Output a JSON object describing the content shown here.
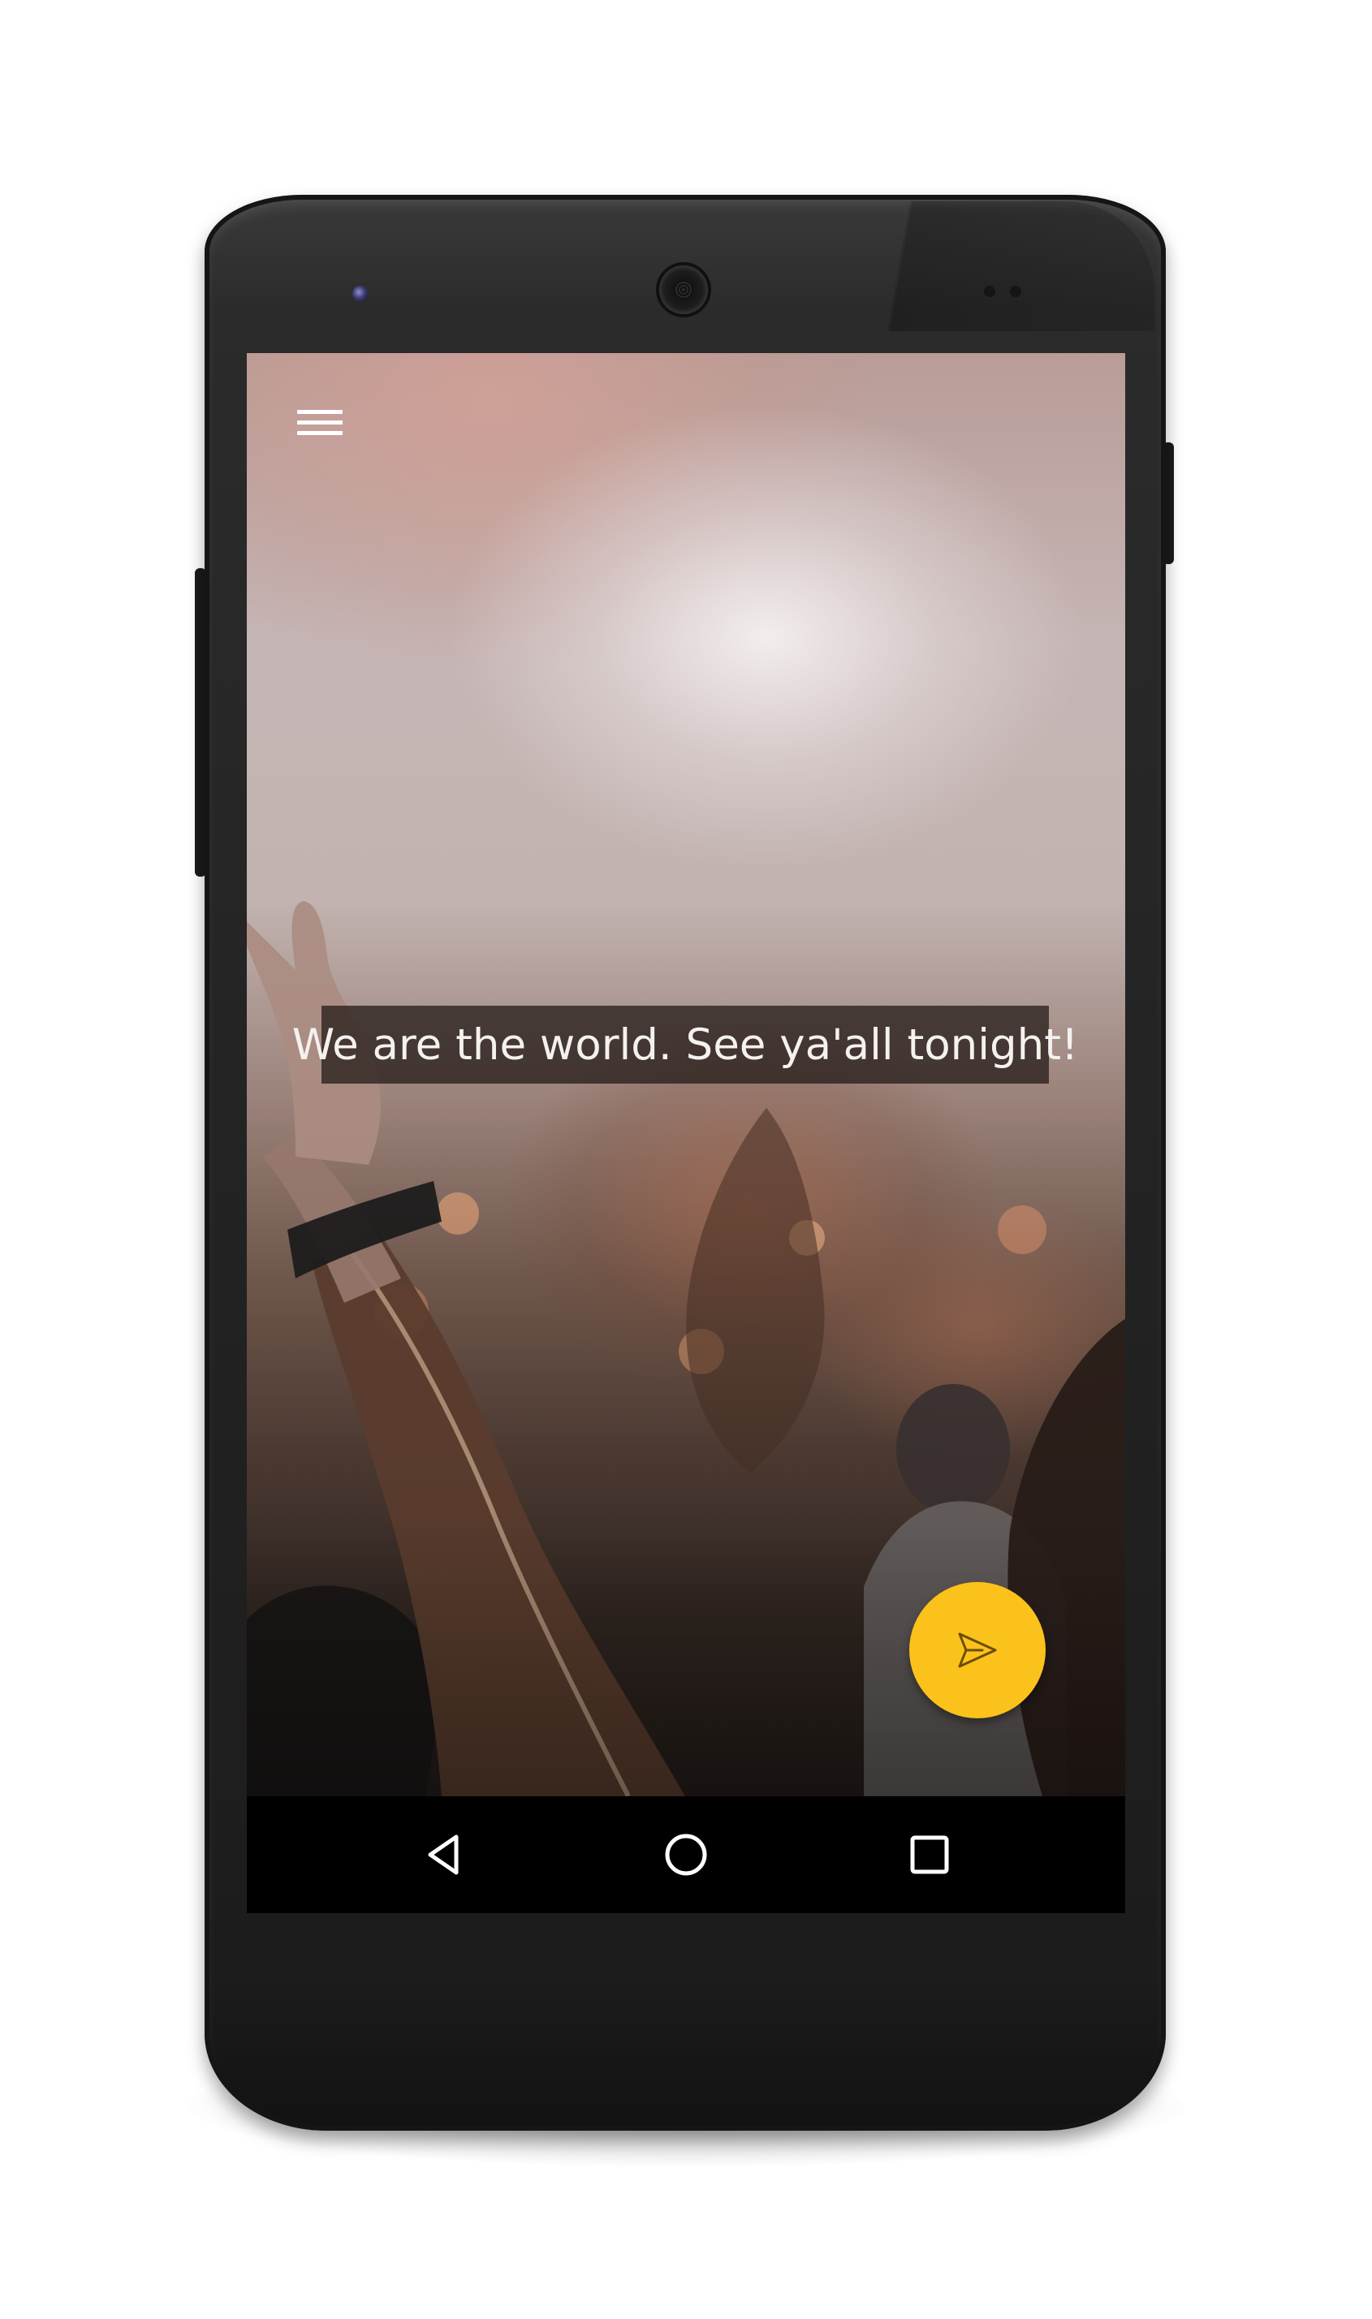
{
  "app": {
    "caption": "We are the world. See ya'all tonight!"
  },
  "toolbar": {
    "menu_icon": "hamburger-menu-icon"
  },
  "fab": {
    "icon": "send-icon",
    "color": "#fbc21c"
  },
  "navigation_bar": {
    "buttons": [
      {
        "name": "back",
        "icon": "triangle-back-icon"
      },
      {
        "name": "home",
        "icon": "circle-home-icon"
      },
      {
        "name": "recents",
        "icon": "square-recents-icon"
      }
    ]
  },
  "device": {
    "type": "android-phone"
  }
}
